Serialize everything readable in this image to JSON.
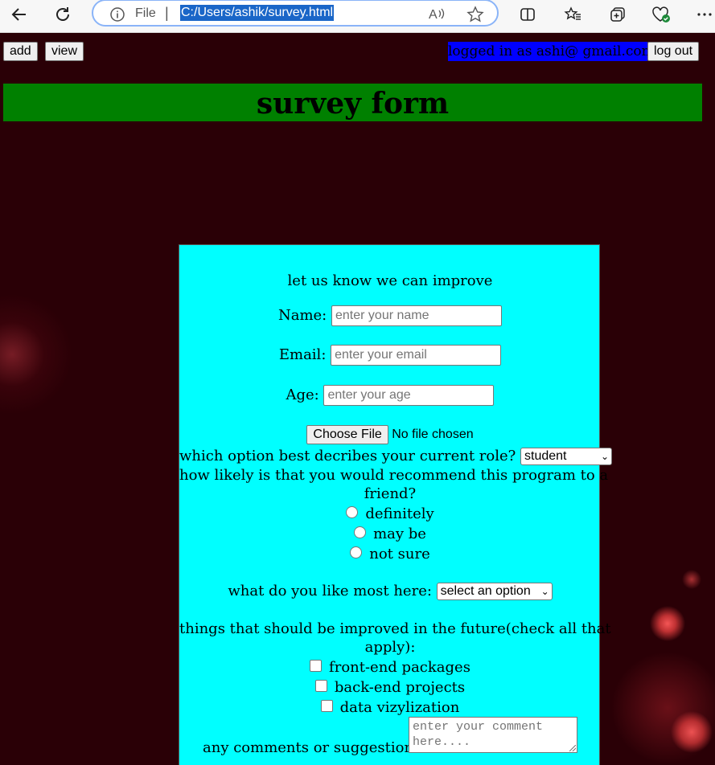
{
  "browser": {
    "file_label": "File",
    "separator": "|",
    "url": "C:/Users/ashik/survey.html"
  },
  "topbar": {
    "add_label": "add",
    "view_label": "view",
    "logged_in_text": "logged in as ashi@ gmail.com",
    "logout_label": "log out"
  },
  "banner": {
    "title": "survey form"
  },
  "form": {
    "intro": "let us know we can improve",
    "name_label": "Name:",
    "name_placeholder": "enter your name",
    "email_label": "Email:",
    "email_placeholder": "enter your email",
    "age_label": "Age:",
    "age_placeholder": "enter your age",
    "file_button": "Choose File",
    "file_status": "No file chosen",
    "role_question": "which option best decribes your current role?",
    "role_selected": "student",
    "recommend_question_line1": "how likely is that you would recommend this program to a",
    "recommend_question_line2": "friend?",
    "recommend_options": [
      "definitely",
      "may be",
      "not sure"
    ],
    "like_question": "what do you like most here:",
    "like_selected": "select an option",
    "improve_question_line1": "things that should be improved in the future(check all that",
    "improve_question_line2": "apply):",
    "improve_options": [
      "front-end packages",
      "back-end projects",
      "data vizylization"
    ],
    "comments_label": "any comments or suggestions?:",
    "comments_placeholder": "enter your comment here...."
  },
  "colors": {
    "page_bg": "#2a0006",
    "banner_bg": "#008000",
    "form_bg": "#00ffff",
    "logged_bg": "#0000ff"
  }
}
